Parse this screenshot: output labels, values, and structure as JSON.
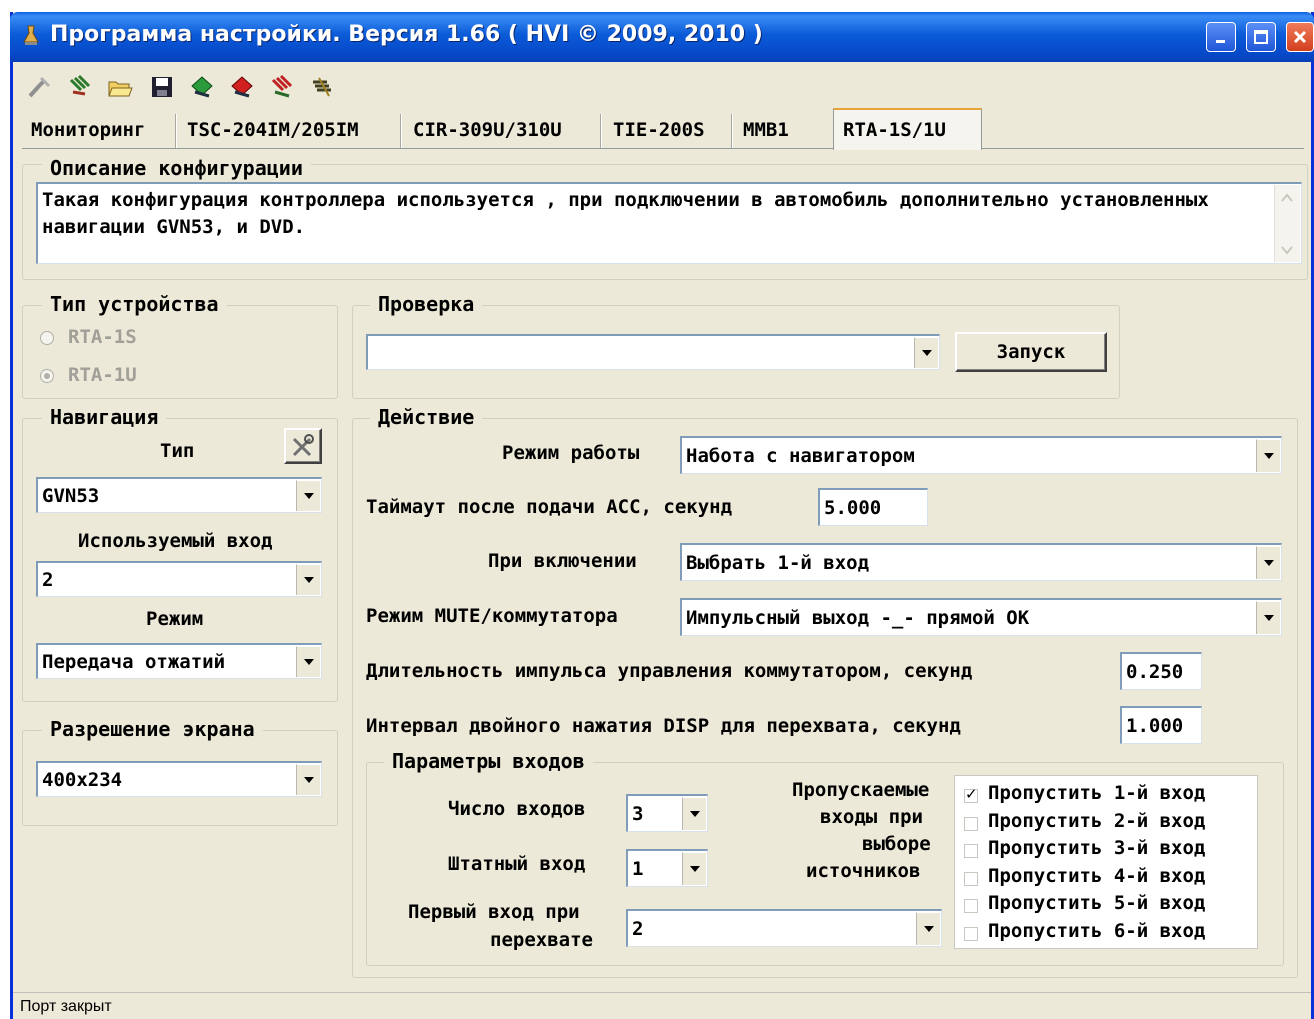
{
  "window": {
    "title": "Программа настройки. Версия 1.66 ( HVI © 2009, 2010 )"
  },
  "toolbar": {
    "icons": [
      "connect-icon",
      "read-config-icon",
      "open-file-icon",
      "save-file-icon",
      "upload-icon",
      "download-icon",
      "reset-icon",
      "write-icon"
    ]
  },
  "tabs": [
    "Мониторинг",
    "TSC-204IM/205IM",
    "CIR-309U/310U",
    "TIE-200S",
    "MMB1",
    "RTA-1S/1U"
  ],
  "description": {
    "title": "Описание конфигурации",
    "text": "Такая конфигурация контроллера используется , при подключении в автомобиль дополнительно установленных навигации GVN53, и DVD."
  },
  "device_type": {
    "title": "Тип устройства",
    "options": [
      "RTA-1S",
      "RTA-1U"
    ],
    "selected": "RTA-1U"
  },
  "check": {
    "title": "Проверка",
    "value": "",
    "run_label": "Запуск"
  },
  "navigation": {
    "title": "Навигация",
    "type_label": "Тип",
    "type_value": "GVN53",
    "input_label": "Используемый вход",
    "input_value": "2",
    "mode_label": "Режим",
    "mode_value": "Передача отжатий"
  },
  "resolution": {
    "title": "Разрешение экрана",
    "value": "400x234"
  },
  "action": {
    "title": "Действие",
    "work_mode_label": "Режим работы",
    "work_mode_value": "Набота с навигатором",
    "timeout_label": "Таймаут после подачи ACC, секунд",
    "timeout_value": "5.000",
    "on_power_label": "При включении",
    "on_power_value": "Выбрать 1-й вход",
    "mute_label": "Режим MUTE/коммутатора",
    "mute_value": "Импульсный выход -_- прямой OK",
    "pulse_label": "Длительность импульса управления коммутатором, секунд",
    "pulse_value": "0.250",
    "disp_label": "Интервал двойного нажатия DISP для перехвата, секунд",
    "disp_value": "1.000"
  },
  "inputs": {
    "title": "Параметры входов",
    "count_label": "Число входов",
    "count_value": "3",
    "native_label": "Штатный вход",
    "native_value": "1",
    "first_label_1": "Первый вход при",
    "first_label_2": "перехвате",
    "first_value": "2",
    "skip_label_1": "Пропускаемые",
    "skip_label_2": "входы при",
    "skip_label_3": "выборе",
    "skip_label_4": "источников",
    "skip_items": [
      {
        "label": "Пропустить 1-й вход",
        "checked": true
      },
      {
        "label": "Пропустить 2-й вход",
        "checked": false
      },
      {
        "label": "Пропустить 3-й вход",
        "checked": false
      },
      {
        "label": "Пропустить 4-й вход",
        "checked": false
      },
      {
        "label": "Пропустить 5-й вход",
        "checked": false
      },
      {
        "label": "Пропустить 6-й вход",
        "checked": false
      }
    ]
  },
  "status": {
    "text": "Порт закрыт"
  }
}
